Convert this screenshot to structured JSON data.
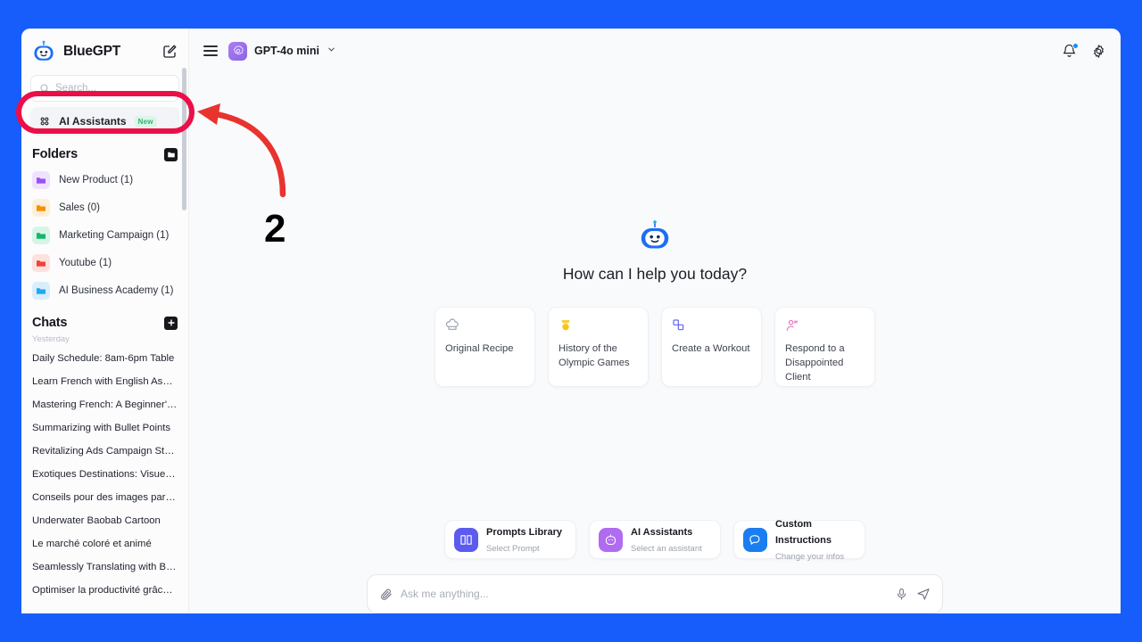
{
  "theme": {
    "page_bg": "#165DFB",
    "accent_blue": "#1a8cff",
    "annotation_red": "#ec0f47",
    "badge_green": "#29b473"
  },
  "sidebar": {
    "brand": "BlueGPT",
    "compose_icon": "compose-icon",
    "search": {
      "placeholder": "Search...",
      "icon": "search-icon"
    },
    "nav": {
      "ai_assistants": {
        "label": "AI Assistants",
        "badge": "New",
        "icon": "grid-apps-icon"
      }
    },
    "folders_section": {
      "title": "Folders",
      "add_icon": "add-folder-icon"
    },
    "folders": [
      {
        "label": "New Product (1)",
        "color": "#9b51f5",
        "bg": "#efe2fe"
      },
      {
        "label": "Sales (0)",
        "color": "#f79009",
        "bg": "#fdf0d8"
      },
      {
        "label": "Marketing Campaign (1)",
        "color": "#12b76a",
        "bg": "#d7f5e6"
      },
      {
        "label": "Youtube (1)",
        "color": "#f04438",
        "bg": "#fde1de"
      },
      {
        "label": "AI Business Academy (1)",
        "color": "#22a9ee",
        "bg": "#d8eefc"
      }
    ],
    "chats_section": {
      "title": "Chats",
      "add_icon": "new-chat-icon"
    },
    "chats_day_label": "Yesterday",
    "chats": [
      "Daily Schedule: 8am-6pm Table",
      "Learn French with English Assis...",
      "Mastering French: A Beginner's ...",
      "Summarizing with Bullet Points",
      "Revitalizing Ads Campaign Stra...",
      "Exotiques Destinations: Visuels ...",
      "Conseils pour des images parfa...",
      "Underwater Baobab Cartoon",
      "Le marché coloré et animé",
      "Seamlessly Translating with Bili...",
      "Optimiser la productivité grâce ..."
    ]
  },
  "topbar": {
    "menu_icon": "hamburger-icon",
    "model": {
      "name": "GPT-4o mini",
      "icon": "openai-model-icon",
      "chevron": "chevron-down-icon"
    },
    "notifications_icon": "bell-icon",
    "has_notification": true,
    "settings_icon": "gear-icon"
  },
  "hero": {
    "mascot_icon": "robot-mascot-icon",
    "title": "How can I help you today?",
    "cards": [
      {
        "label": "Original Recipe",
        "icon": "chef-hat-icon",
        "color": "#9aa1ad"
      },
      {
        "label": "History of the Olympic Games",
        "icon": "medal-icon",
        "color": "#f5c518"
      },
      {
        "label": "Create a Workout",
        "icon": "dumbbell-icon",
        "color": "#6366f1"
      },
      {
        "label": "Respond to a Disappointed Client",
        "icon": "person-unhappy-icon",
        "color": "#e879c3"
      }
    ]
  },
  "quick_actions": [
    {
      "title": "Prompts Library",
      "subtitle": "Select Prompt",
      "icon": "book-icon",
      "color": "#5b5bf0"
    },
    {
      "title": "AI Assistants",
      "subtitle": "Select an assistant",
      "icon": "robot-icon",
      "color": "#b06cf0"
    },
    {
      "title": "Custom Instructions",
      "subtitle": "Change your infos",
      "icon": "chat-bubble-icon",
      "color": "#1a7ef0"
    }
  ],
  "composer": {
    "placeholder": "Ask me anything...",
    "attach_icon": "paperclip-icon",
    "mic_icon": "microphone-icon",
    "send_icon": "send-icon"
  },
  "annotation": {
    "step_number": "2",
    "highlight_target": "AI Assistants",
    "arrow_icon": "curved-arrow-icon"
  }
}
